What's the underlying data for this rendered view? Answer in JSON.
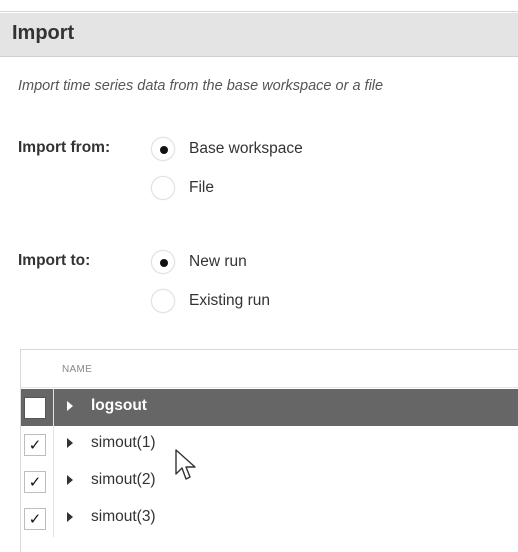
{
  "header": {
    "title": "Import"
  },
  "description": "Import time series data from the base workspace or a file",
  "import_from": {
    "label": "Import from:",
    "options": [
      {
        "label": "Base workspace",
        "selected": true
      },
      {
        "label": "File",
        "selected": false
      }
    ]
  },
  "import_to": {
    "label": "Import to:",
    "options": [
      {
        "label": "New run",
        "selected": true
      },
      {
        "label": "Existing run",
        "selected": false
      }
    ]
  },
  "table": {
    "column_header": "NAME",
    "rows": [
      {
        "label": "logsout",
        "checked": false,
        "selected": true,
        "check_glyph": ""
      },
      {
        "label": "simout(1)",
        "checked": true,
        "selected": false,
        "check_glyph": "✓"
      },
      {
        "label": "simout(2)",
        "checked": true,
        "selected": false,
        "check_glyph": "✓"
      },
      {
        "label": "simout(3)",
        "checked": true,
        "selected": false,
        "check_glyph": "✓"
      }
    ]
  },
  "icons": {
    "expander": "triangle-right-icon",
    "cursor": "mouse-pointer-icon",
    "check": "checkmark-icon"
  }
}
